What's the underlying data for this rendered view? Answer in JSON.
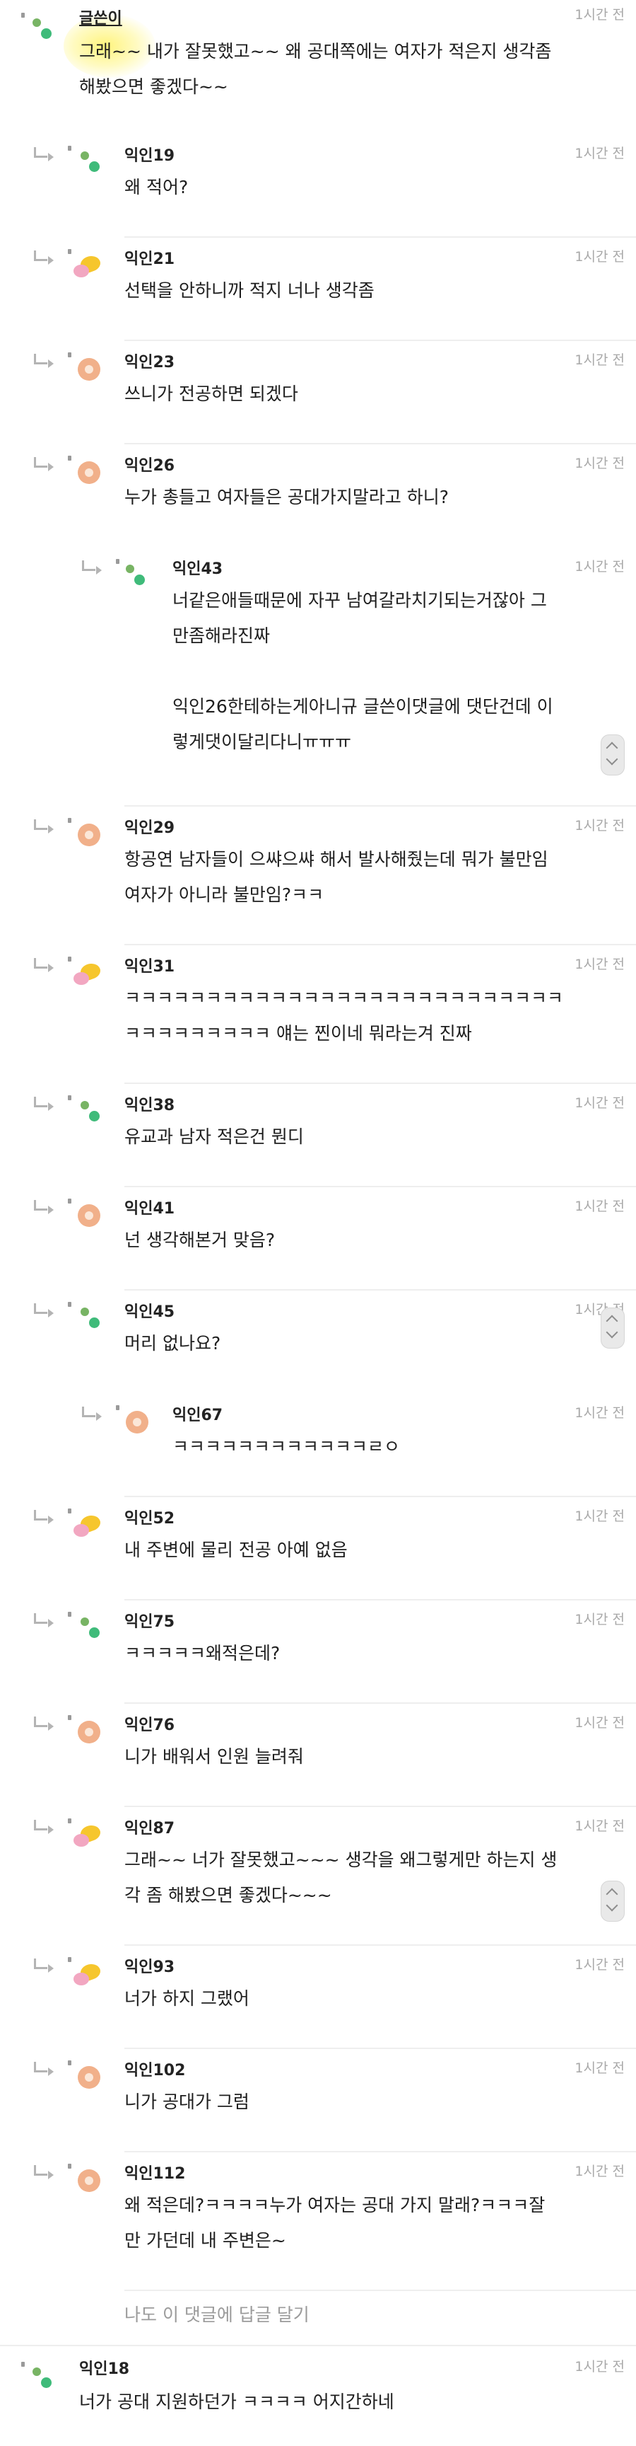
{
  "thread": {
    "reply_link": "나도 이 댓글에 답글 달기",
    "comments": [
      {
        "name": "글쓴이",
        "time": "1시간 전",
        "avatar": "green",
        "lines": [
          "그래~~ 내가 잘못했고~~ 왜 공대쪽에는 여자가 적은지 생각좀",
          "해봤으면 좋겠다~~"
        ]
      },
      {
        "name": "익인19",
        "time": "1시간 전",
        "avatar": "green",
        "lines": [
          "왜 적어?"
        ]
      },
      {
        "name": "익인21",
        "time": "1시간 전",
        "avatar": "yellow-pink",
        "lines": [
          "선택을 안하니까 적지 너나 생각좀"
        ]
      },
      {
        "name": "익인23",
        "time": "1시간 전",
        "avatar": "orange",
        "lines": [
          "쓰니가 전공하면 되겠다"
        ]
      },
      {
        "name": "익인26",
        "time": "1시간 전",
        "avatar": "orange",
        "lines": [
          "누가 총들고 여자들은 공대가지말라고 하니?"
        ]
      },
      {
        "name": "익인43",
        "time": "1시간 전",
        "avatar": "green",
        "lines": [
          "너같은애들때문에 자꾸 남여갈라치기되는거잖아 그",
          "만좀해라진짜",
          "",
          "익인26한테하는게아니규 글쓴이댓글에 댓단건데 이",
          "렇게댓이달리다니ㅠㅠㅠ"
        ]
      },
      {
        "name": "익인29",
        "time": "1시간 전",
        "avatar": "orange",
        "lines": [
          "항공연 남자들이 으쌰으쌰 해서 발사해줬는데 뭐가 불만임",
          "여자가 아니라 불만임?ㅋㅋ"
        ]
      },
      {
        "name": "익인31",
        "time": "1시간 전",
        "avatar": "yellow-pink",
        "lines": [
          "ㅋㅋㅋㅋㅋㅋㅋㅋㅋㅋㅋㅋㅋㅋㅋㅋㅋㅋㅋㅋㅋㅋㅋㅋㅋㅋㅋ",
          "ㅋㅋㅋㅋㅋㅋㅋㅋㅋ 얘는 찐이네 뭐라는겨 진짜"
        ]
      },
      {
        "name": "익인38",
        "time": "1시간 전",
        "avatar": "green",
        "lines": [
          "유교과 남자 적은건 뭔디"
        ]
      },
      {
        "name": "익인41",
        "time": "1시간 전",
        "avatar": "orange",
        "lines": [
          "넌 생각해본거 맞음?"
        ]
      },
      {
        "name": "익인45",
        "time": "1시간 전",
        "avatar": "green",
        "lines": [
          "머리 없나요?"
        ]
      },
      {
        "name": "익인67",
        "time": "1시간 전",
        "avatar": "orange",
        "lines": [
          "ㅋㅋㅋㅋㅋㅋㅋㅋㅋㅋㅋㅋㄹㅇ"
        ]
      },
      {
        "name": "익인52",
        "time": "1시간 전",
        "avatar": "yellow-pink",
        "lines": [
          "내 주변에 물리 전공 아예 없음"
        ]
      },
      {
        "name": "익인75",
        "time": "1시간 전",
        "avatar": "green",
        "lines": [
          "ㅋㅋㅋㅋㅋ왜적은데?"
        ]
      },
      {
        "name": "익인76",
        "time": "1시간 전",
        "avatar": "orange",
        "lines": [
          "니가 배워서 인원 늘려줘"
        ]
      },
      {
        "name": "익인87",
        "time": "1시간 전",
        "avatar": "yellow-pink",
        "lines": [
          "그래~~ 너가 잘못했고~~~ 생각을 왜그렇게만 하는지 생",
          "각 좀 해봤으면 좋겠다~~~"
        ]
      },
      {
        "name": "익인93",
        "time": "1시간 전",
        "avatar": "yellow-pink",
        "lines": [
          "너가 하지 그랬어"
        ]
      },
      {
        "name": "익인102",
        "time": "1시간 전",
        "avatar": "orange",
        "lines": [
          "니가 공대가 그럼"
        ]
      },
      {
        "name": "익인112",
        "time": "1시간 전",
        "avatar": "orange",
        "lines": [
          "왜 적은데?ㅋㅋㅋㅋ누가 여자는 공대 가지 말래?ㅋㅋㅋ잘",
          "만 가던데 내 주변은~"
        ]
      },
      {
        "name": "익인18",
        "time": "1시간 전",
        "avatar": "green",
        "lines": [
          "너가 공대 지원하던가 ㅋㅋㅋㅋ 어지간하네"
        ]
      }
    ]
  }
}
